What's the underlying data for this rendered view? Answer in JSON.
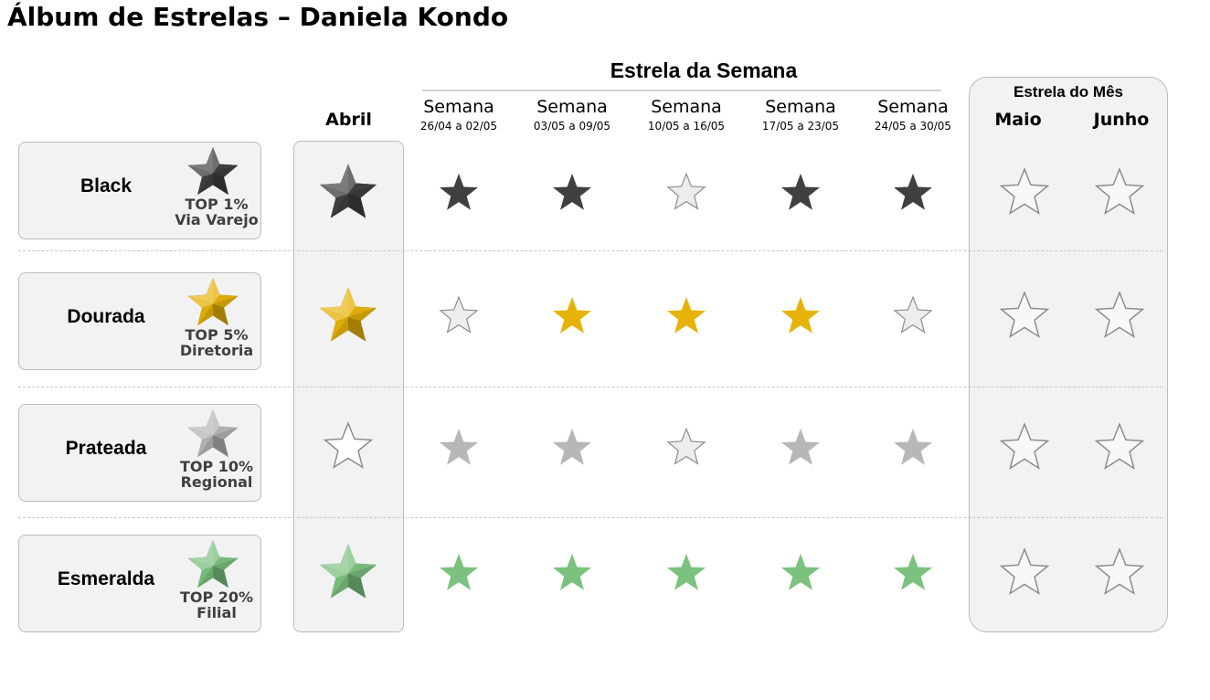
{
  "title": "Álbum de Estrelas – Daniela Kondo",
  "weekly_section": {
    "title": "Estrela da Semana",
    "weeks": [
      {
        "label": "Semana",
        "dates": "26/04 a 02/05"
      },
      {
        "label": "Semana",
        "dates": "03/05 a 09/05"
      },
      {
        "label": "Semana",
        "dates": "10/05 a 16/05"
      },
      {
        "label": "Semana",
        "dates": "17/05 a 23/05"
      },
      {
        "label": "Semana",
        "dates": "24/05 a 30/05"
      }
    ]
  },
  "april_column": {
    "label": "Abril"
  },
  "monthly_section": {
    "title": "Estrela do Mês",
    "months": [
      "Maio",
      "Junho"
    ]
  },
  "colors": {
    "black": "#404040",
    "gold": "#e7b30a",
    "silver": "#b7b7b7",
    "emerald": "#7cc27f",
    "empty_fill": "#ededed",
    "panel_bg": "#f2f2f2"
  },
  "levels": [
    {
      "name": "Black",
      "top": "TOP  1%",
      "scope": "Via Varejo",
      "icon": "black-star-icon",
      "april": true,
      "weeks": [
        true,
        true,
        false,
        true,
        true
      ],
      "months": [
        false,
        false
      ]
    },
    {
      "name": "Dourada",
      "top": "TOP  5%",
      "scope": "Diretoria",
      "icon": "gold-star-icon",
      "april": true,
      "weeks": [
        false,
        true,
        true,
        true,
        false
      ],
      "months": [
        false,
        false
      ]
    },
    {
      "name": "Prateada",
      "top": "TOP  10%",
      "scope": "Regional",
      "icon": "silver-star-icon",
      "april": false,
      "weeks": [
        true,
        true,
        false,
        true,
        true
      ],
      "months": [
        false,
        false
      ]
    },
    {
      "name": "Esmeralda",
      "top": "TOP  20%",
      "scope": "Filial",
      "icon": "emerald-star-icon",
      "april": true,
      "weeks": [
        true,
        true,
        true,
        true,
        true
      ],
      "months": [
        false,
        false
      ]
    }
  ]
}
